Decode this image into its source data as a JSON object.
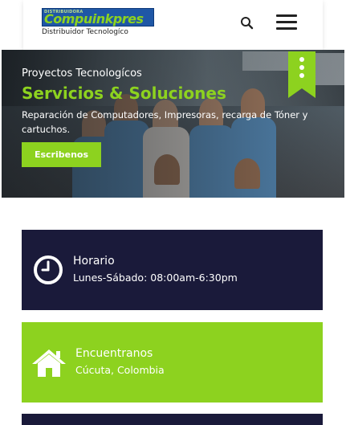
{
  "header": {
    "logo": {
      "tiny_text": "DISTRIBUIDORA",
      "brand": "Compuinkpres",
      "tagline": "Distribuidor Tecnologíco"
    },
    "search_icon": "search-icon",
    "menu_icon": "hamburger-menu-icon"
  },
  "hero": {
    "subtitle": "Proyectos Tecnologícos",
    "title": "Servicios & Soluciones",
    "description": "Reparación de Computadores, Impresoras, recarga de Tóner y cartuchos.",
    "button_label": "Escribenos",
    "ribbon_icon": "more-dots-bookmark-icon"
  },
  "cards": [
    {
      "icon": "clock-icon",
      "title": "Horario",
      "text": "Lunes-Sábado: 08:00am-6:30pm"
    },
    {
      "icon": "home-icon",
      "title": "Encuentranos",
      "text": "Cúcuta, Colombia"
    }
  ],
  "colors": {
    "accent_green": "#8dd21f",
    "dark_navy": "#1a1a3a",
    "logo_blue": "#1f57a6"
  }
}
